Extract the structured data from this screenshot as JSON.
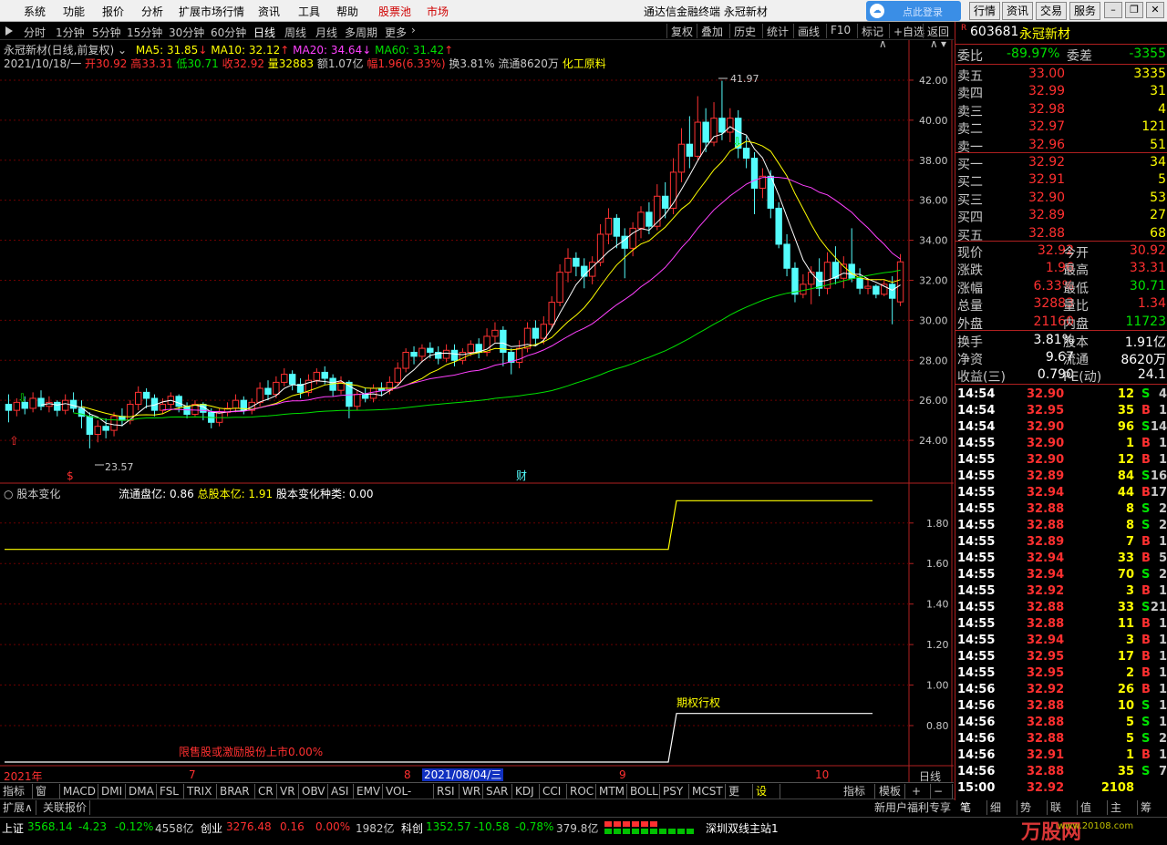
{
  "menu": {
    "items": [
      "系统",
      "功能",
      "报价",
      "分析",
      "扩展市场行情",
      "资讯",
      "工具",
      "帮助",
      "股票池",
      "市场"
    ],
    "app_title": "通达信金融终端 永冠新材",
    "login_label": "点此登录",
    "right_buttons": [
      "行情",
      "资讯",
      "交易",
      "服务"
    ]
  },
  "period": {
    "items": [
      "分时",
      "1分钟",
      "5分钟",
      "15分钟",
      "30分钟",
      "60分钟",
      "日线",
      "周线",
      "月线",
      "多周期",
      "更多"
    ],
    "active": "日线",
    "tools": [
      "复权",
      "叠加",
      "历史",
      "统计",
      "画线",
      "F10",
      "标记",
      "+自选",
      "返回"
    ]
  },
  "chart_header": {
    "name": "永冠新材(日线,前复权)",
    "ma5": "MA5: 31.85",
    "ma10": "MA10: 32.12",
    "ma20": "MA20: 34.64",
    "ma60": "MA60: 31.42",
    "date": "2021/10/18/一",
    "open": "开30.92",
    "high": "高33.31",
    "low": "低30.71",
    "close": "收32.92",
    "vol": "量32883",
    "amt": "额1.07亿",
    "chg": "幅1.96(6.33%)",
    "turn": "换3.81%",
    "float": "流通8620万",
    "industry": "化工原料"
  },
  "chart_data": [
    {
      "type": "candlestick",
      "title": "永冠新材(日线,前复权)",
      "ylim": [
        22.5,
        43.0
      ],
      "yticks": [
        "42.00",
        "40.00",
        "38.00",
        "36.00",
        "34.00",
        "32.00",
        "30.00",
        "28.00",
        "26.00",
        "24.00"
      ],
      "annotations": {
        "max": "41.97",
        "min": "23.57",
        "marker_s": "$",
        "marker_cai": "财"
      },
      "candles": [
        [
          25.8,
          25.5,
          26.3,
          24.9
        ],
        [
          25.5,
          25.9,
          26.1,
          25.2
        ],
        [
          25.9,
          25.6,
          26.2,
          25.3
        ],
        [
          25.6,
          26.1,
          26.4,
          25.4
        ],
        [
          26.1,
          25.7,
          26.5,
          25.5
        ],
        [
          25.7,
          25.9,
          26.2,
          25.4
        ],
        [
          25.9,
          25.5,
          26.0,
          25.2
        ],
        [
          25.5,
          26.0,
          26.3,
          25.3
        ],
        [
          26.0,
          25.6,
          26.4,
          25.4
        ],
        [
          25.6,
          25.2,
          26.0,
          24.6
        ],
        [
          25.2,
          24.3,
          25.4,
          23.6
        ],
        [
          24.3,
          24.7,
          25.0,
          23.9
        ],
        [
          24.7,
          24.5,
          25.1,
          24.1
        ],
        [
          24.5,
          25.2,
          25.4,
          24.2
        ],
        [
          25.2,
          25.0,
          25.6,
          24.7
        ],
        [
          25.0,
          25.8,
          26.0,
          24.8
        ],
        [
          25.8,
          26.4,
          26.7,
          25.5
        ],
        [
          26.4,
          26.1,
          26.6,
          25.6
        ],
        [
          26.1,
          25.5,
          26.3,
          25.2
        ],
        [
          25.5,
          25.8,
          26.1,
          25.3
        ],
        [
          25.8,
          26.2,
          26.4,
          25.6
        ],
        [
          26.2,
          25.7,
          26.3,
          25.4
        ],
        [
          25.7,
          25.3,
          25.9,
          25.1
        ],
        [
          25.3,
          25.8,
          26.0,
          25.2
        ],
        [
          25.8,
          25.4,
          25.9,
          25.0
        ],
        [
          25.4,
          24.9,
          25.6,
          24.6
        ],
        [
          24.9,
          25.4,
          25.6,
          24.7
        ],
        [
          25.4,
          25.6,
          25.9,
          25.2
        ],
        [
          25.6,
          26.0,
          26.3,
          25.4
        ],
        [
          26.0,
          25.5,
          26.2,
          25.3
        ],
        [
          25.5,
          25.9,
          26.1,
          25.3
        ],
        [
          25.9,
          26.6,
          26.9,
          25.7
        ],
        [
          26.6,
          26.3,
          27.0,
          26.0
        ],
        [
          26.3,
          26.9,
          27.2,
          26.1
        ],
        [
          26.9,
          27.3,
          27.6,
          26.7
        ],
        [
          27.3,
          26.8,
          27.5,
          26.5
        ],
        [
          26.8,
          26.4,
          27.1,
          26.1
        ],
        [
          26.4,
          27.0,
          27.3,
          26.2
        ],
        [
          27.0,
          27.4,
          27.6,
          26.8
        ],
        [
          27.4,
          27.1,
          27.7,
          26.8
        ],
        [
          27.1,
          26.5,
          27.3,
          26.2
        ],
        [
          26.5,
          26.9,
          27.2,
          26.3
        ],
        [
          26.9,
          25.7,
          27.0,
          25.1
        ],
        [
          25.7,
          26.3,
          26.5,
          25.5
        ],
        [
          26.3,
          26.1,
          26.6,
          25.9
        ],
        [
          26.1,
          26.6,
          26.8,
          25.9
        ],
        [
          26.6,
          26.5,
          26.9,
          26.2
        ],
        [
          26.5,
          26.9,
          27.2,
          26.3
        ],
        [
          26.9,
          27.6,
          27.9,
          26.7
        ],
        [
          27.6,
          28.4,
          28.6,
          27.4
        ],
        [
          28.4,
          28.2,
          28.7,
          27.8
        ],
        [
          28.2,
          28.6,
          28.8,
          27.9
        ],
        [
          28.6,
          28.4,
          28.9,
          28.1
        ],
        [
          28.4,
          28.1,
          28.7,
          27.8
        ],
        [
          28.1,
          28.5,
          28.8,
          27.9
        ],
        [
          28.5,
          28.0,
          28.8,
          27.7
        ],
        [
          28.0,
          28.4,
          28.6,
          27.8
        ],
        [
          28.4,
          28.8,
          29.0,
          28.2
        ],
        [
          28.8,
          28.4,
          29.1,
          28.1
        ],
        [
          28.4,
          29.2,
          29.6,
          28.2
        ],
        [
          29.2,
          29.5,
          29.9,
          28.9
        ],
        [
          29.5,
          28.4,
          29.7,
          27.7
        ],
        [
          28.4,
          27.9,
          28.6,
          27.3
        ],
        [
          27.9,
          28.6,
          29.0,
          27.6
        ],
        [
          28.6,
          29.6,
          29.9,
          28.4
        ],
        [
          29.6,
          29.1,
          30.0,
          28.7
        ],
        [
          29.1,
          29.8,
          30.2,
          28.8
        ],
        [
          29.8,
          30.9,
          31.2,
          29.6
        ],
        [
          30.9,
          32.4,
          32.8,
          30.7
        ],
        [
          32.4,
          33.1,
          33.6,
          31.9
        ],
        [
          33.1,
          32.7,
          33.4,
          32.2
        ],
        [
          32.7,
          32.2,
          33.1,
          31.6
        ],
        [
          32.2,
          32.9,
          33.2,
          31.8
        ],
        [
          32.9,
          34.3,
          34.8,
          32.7
        ],
        [
          34.3,
          35.1,
          35.6,
          33.8
        ],
        [
          35.1,
          34.2,
          35.3,
          33.6
        ],
        [
          34.2,
          33.6,
          34.6,
          32.1
        ],
        [
          33.6,
          34.6,
          34.9,
          33.2
        ],
        [
          34.6,
          35.4,
          35.7,
          34.1
        ],
        [
          35.4,
          34.7,
          35.9,
          34.3
        ],
        [
          34.7,
          36.2,
          36.8,
          34.5
        ],
        [
          36.2,
          35.6,
          36.9,
          35.1
        ],
        [
          35.6,
          37.4,
          38.1,
          35.3
        ],
        [
          37.4,
          38.8,
          39.6,
          36.9
        ],
        [
          38.8,
          38.2,
          40.2,
          37.6
        ],
        [
          38.2,
          39.9,
          41.2,
          38.0
        ],
        [
          39.9,
          38.9,
          40.6,
          38.4
        ],
        [
          38.9,
          40.1,
          40.9,
          38.7
        ],
        [
          40.1,
          39.4,
          41.97,
          39.0
        ],
        [
          39.4,
          40.1,
          40.6,
          38.9
        ],
        [
          40.1,
          38.6,
          40.5,
          38.1
        ],
        [
          38.6,
          38.1,
          39.2,
          37.6
        ],
        [
          38.1,
          36.6,
          38.4,
          35.3
        ],
        [
          36.6,
          37.2,
          37.6,
          36.1
        ],
        [
          37.2,
          35.6,
          37.5,
          35.1
        ],
        [
          35.6,
          33.8,
          35.9,
          33.6
        ],
        [
          33.8,
          32.6,
          34.3,
          32.2
        ],
        [
          32.6,
          31.3,
          32.9,
          30.9
        ],
        [
          31.3,
          31.8,
          32.3,
          31.1
        ],
        [
          31.8,
          32.4,
          32.7,
          30.8
        ],
        [
          32.4,
          31.6,
          33.1,
          31.2
        ],
        [
          31.6,
          32.9,
          33.4,
          31.3
        ],
        [
          32.9,
          32.1,
          33.7,
          31.8
        ],
        [
          32.1,
          32.8,
          33.2,
          31.6
        ],
        [
          32.8,
          32.1,
          34.6,
          31.9
        ],
        [
          32.1,
          31.6,
          32.6,
          31.3
        ],
        [
          31.6,
          31.7,
          32.1,
          31.3
        ],
        [
          31.7,
          31.3,
          31.8,
          31.1
        ],
        [
          31.3,
          31.8,
          32.0,
          31.2
        ],
        [
          31.8,
          31.1,
          32.2,
          29.8
        ],
        [
          30.92,
          32.92,
          33.31,
          30.71
        ]
      ]
    },
    {
      "type": "line",
      "title": "股本变化",
      "ylim": [
        0.62,
        1.97
      ],
      "yticks": [
        "1.80",
        "1.60",
        "1.40",
        "1.20",
        "1.00",
        "0.80"
      ],
      "series": [
        {
          "name": "总股本亿",
          "color": "#ffff00",
          "values": [
            1.67,
            1.91
          ]
        },
        {
          "name": "期权行权",
          "color": "#ffffff",
          "values": [
            0.62,
            0.86
          ]
        }
      ]
    }
  ],
  "sub_header": {
    "label": "股本变化",
    "float_cap": "流通盘亿: 0.86",
    "total_cap": "总股本亿: 1.91",
    "change_type": "股本变化种类: 0.00",
    "option_label": "期权行权",
    "restricted_label": "限售股或激励股份上市0.00%"
  },
  "xaxis": {
    "labels": [
      "2021年",
      "7",
      "8",
      "9",
      "10"
    ],
    "cursor_date": "2021/08/04/三",
    "period_label": "日线"
  },
  "indicators": {
    "tabs": [
      "指标A",
      "窗口",
      "MACD",
      "DMI",
      "DMA",
      "FSL",
      "TRIX",
      "BRAR",
      "CR",
      "VR",
      "OBV",
      "ASI",
      "EMV",
      "VOL-TDX",
      "RSI",
      "WR",
      "SAR",
      "KDJ",
      "CCI",
      "ROC",
      "MTM",
      "BOLL",
      "PSY",
      "MCST",
      "更多",
      "设置"
    ],
    "right_tabs": [
      "指标B",
      "模板",
      "+",
      "−"
    ]
  },
  "bottom": {
    "tab1": "扩展∧",
    "tab2": "关联报价",
    "promo": "新用户福利专享",
    "panel_tabs": [
      "笔",
      "细",
      "势",
      "联",
      "值",
      "主",
      "筹"
    ]
  },
  "stock": {
    "flag": "R",
    "code": "603681",
    "name": "永冠新材",
    "weibi_label": "委比",
    "weibi": "-89.97%",
    "weicha_label": "委差",
    "weicha": "-3355",
    "asks": [
      {
        "label": "卖五",
        "price": "33.00",
        "vol": "3335"
      },
      {
        "label": "卖四",
        "price": "32.99",
        "vol": "31"
      },
      {
        "label": "卖三",
        "price": "32.98",
        "vol": "4"
      },
      {
        "label": "卖二",
        "price": "32.97",
        "vol": "121"
      },
      {
        "label": "卖一",
        "price": "32.96",
        "vol": "51"
      }
    ],
    "bids": [
      {
        "label": "买一",
        "price": "32.92",
        "vol": "34"
      },
      {
        "label": "买二",
        "price": "32.91",
        "vol": "5"
      },
      {
        "label": "买三",
        "price": "32.90",
        "vol": "53"
      },
      {
        "label": "买四",
        "price": "32.89",
        "vol": "27"
      },
      {
        "label": "买五",
        "price": "32.88",
        "vol": "68"
      }
    ],
    "quote": [
      [
        "现价",
        "32.92",
        "今开",
        "30.92"
      ],
      [
        "涨跌",
        "1.96",
        "最高",
        "33.31"
      ],
      [
        "涨幅",
        "6.33%",
        "最低",
        "30.71"
      ],
      [
        "总量",
        "32883",
        "量比",
        "1.34"
      ],
      [
        "外盘",
        "21160",
        "内盘",
        "11723"
      ]
    ],
    "fund": [
      [
        "换手",
        "3.81%",
        "股本",
        "1.91亿"
      ],
      [
        "净资",
        "9.67",
        "流通",
        "8620万"
      ],
      [
        "收益(三)",
        "0.790",
        "PE(动)",
        "24.1"
      ]
    ]
  },
  "ticks": [
    [
      "14:54",
      "32.90",
      "12",
      "S",
      "4"
    ],
    [
      "14:54",
      "32.95",
      "35",
      "B",
      "1"
    ],
    [
      "14:54",
      "32.90",
      "96",
      "S",
      "14"
    ],
    [
      "14:55",
      "32.90",
      "1",
      "B",
      "1"
    ],
    [
      "14:55",
      "32.90",
      "12",
      "B",
      "1"
    ],
    [
      "14:55",
      "32.89",
      "84",
      "S",
      "16"
    ],
    [
      "14:55",
      "32.94",
      "44",
      "B",
      "17"
    ],
    [
      "14:55",
      "32.88",
      "8",
      "S",
      "2"
    ],
    [
      "14:55",
      "32.88",
      "8",
      "S",
      "2"
    ],
    [
      "14:55",
      "32.89",
      "7",
      "B",
      "1"
    ],
    [
      "14:55",
      "32.94",
      "33",
      "B",
      "5"
    ],
    [
      "14:55",
      "32.94",
      "70",
      "S",
      "2"
    ],
    [
      "14:55",
      "32.92",
      "3",
      "B",
      "1"
    ],
    [
      "14:55",
      "32.88",
      "33",
      "S",
      "21"
    ],
    [
      "14:55",
      "32.88",
      "11",
      "B",
      "1"
    ],
    [
      "14:55",
      "32.94",
      "3",
      "B",
      "1"
    ],
    [
      "14:55",
      "32.95",
      "17",
      "B",
      "1"
    ],
    [
      "14:55",
      "32.95",
      "2",
      "B",
      "1"
    ],
    [
      "14:56",
      "32.92",
      "26",
      "B",
      "1"
    ],
    [
      "14:56",
      "32.88",
      "10",
      "S",
      "1"
    ],
    [
      "14:56",
      "32.88",
      "5",
      "S",
      "1"
    ],
    [
      "14:56",
      "32.88",
      "5",
      "S",
      "2"
    ],
    [
      "14:56",
      "32.91",
      "1",
      "B",
      "1"
    ],
    [
      "14:56",
      "32.88",
      "35",
      "S",
      "7"
    ],
    [
      "15:00",
      "32.92",
      "2108",
      "",
      ""
    ]
  ],
  "status": {
    "sh_label": "上证",
    "sh_val": "3568.14",
    "sh_chg": "-4.23",
    "sh_pct": "-0.12%",
    "sh_amt": "4558亿",
    "cy_label": "创业",
    "cy_val": "3276.48",
    "cy_chg": "0.16",
    "cy_pct": "0.00%",
    "cy_amt": "1982亿",
    "kc_label": "科创",
    "kc_val": "1352.57",
    "kc_chg": "-10.58",
    "kc_pct": "-0.78%",
    "kc_amt": "379.8亿",
    "server": "深圳双线主站1",
    "watermark": "万股网",
    "watermark_url": "www.20108.com"
  },
  "colors": {
    "up": "#ff3232",
    "down": "#54fcfc",
    "ma5": "#ffffff",
    "ma10": "#ffff00",
    "ma20": "#ff40ff",
    "ma60": "#00e000",
    "grid": "#6b0000"
  }
}
